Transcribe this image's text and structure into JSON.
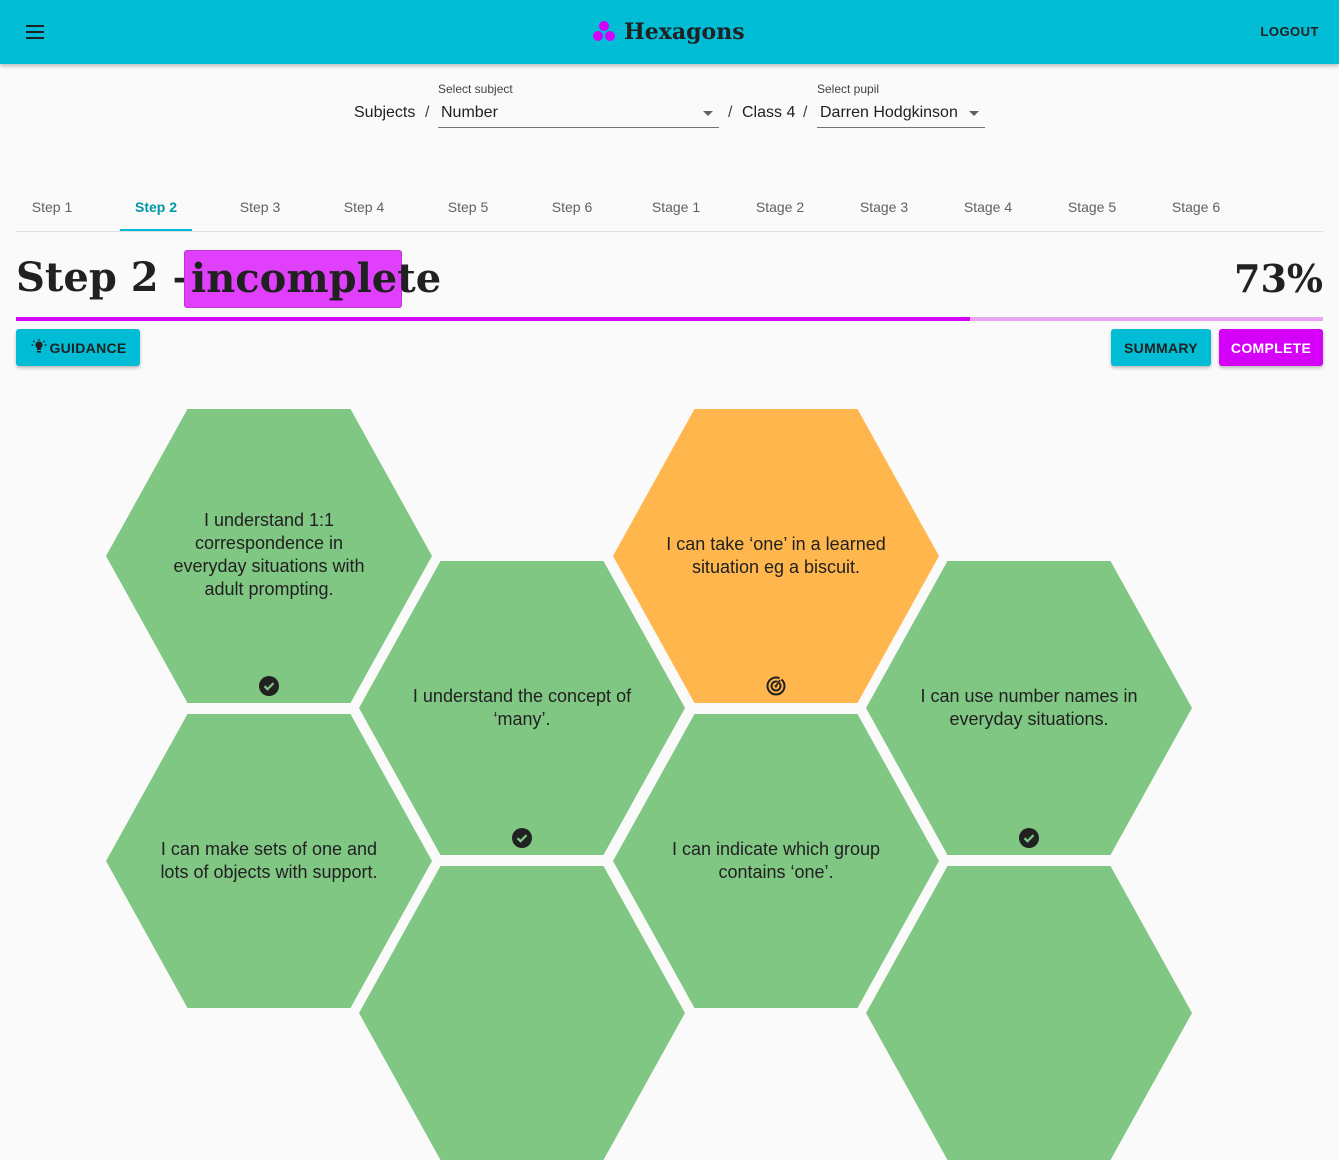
{
  "app": {
    "title": "Hexagons",
    "logout_label": "LOGOUT",
    "brand_color": "#00bcd4",
    "accent_color": "#d500f9"
  },
  "breadcrumb": {
    "root": "Subjects",
    "separator": "/",
    "subject_select": {
      "label": "Select subject",
      "value": "Number"
    },
    "class_name": "Class 4",
    "pupil_select": {
      "label": "Select pupil",
      "value": "Darren Hodgkinson"
    }
  },
  "tabs": [
    {
      "label": "Step 1",
      "active": false
    },
    {
      "label": "Step 2",
      "active": true
    },
    {
      "label": "Step 3",
      "active": false
    },
    {
      "label": "Step 4",
      "active": false
    },
    {
      "label": "Step 5",
      "active": false
    },
    {
      "label": "Step 6",
      "active": false
    },
    {
      "label": "Stage 1",
      "active": false
    },
    {
      "label": "Stage 2",
      "active": false
    },
    {
      "label": "Stage 3",
      "active": false
    },
    {
      "label": "Stage 4",
      "active": false
    },
    {
      "label": "Stage 5",
      "active": false
    },
    {
      "label": "Stage 6",
      "active": false
    }
  ],
  "heading": {
    "title": "Step 2 —",
    "status": "incomplete",
    "percent": "73%",
    "progress_fraction": 0.73
  },
  "actions": {
    "guidance_label": "GUIDANCE",
    "summary_label": "SUMMARY",
    "complete_label": "COMPLETE"
  },
  "hexagons": [
    {
      "text": "I understand 1:1 correspondence in everyday situations with adult prompting.",
      "state": "complete",
      "icon": "check-circle-icon"
    },
    {
      "text": "I understand the concept of ‘many’.",
      "state": "complete",
      "icon": "check-circle-icon"
    },
    {
      "text": "I can take ‘one’ in a learned situation eg a biscuit.",
      "state": "in-progress",
      "icon": "target-icon"
    },
    {
      "text": "I can use number names in everyday situations.",
      "state": "complete",
      "icon": "check-circle-icon"
    },
    {
      "text": "I can make sets of one and lots of objects with support.",
      "state": "complete",
      "icon": ""
    },
    {
      "text": "I can indicate which group contains ‘one’.",
      "state": "complete",
      "icon": ""
    }
  ]
}
